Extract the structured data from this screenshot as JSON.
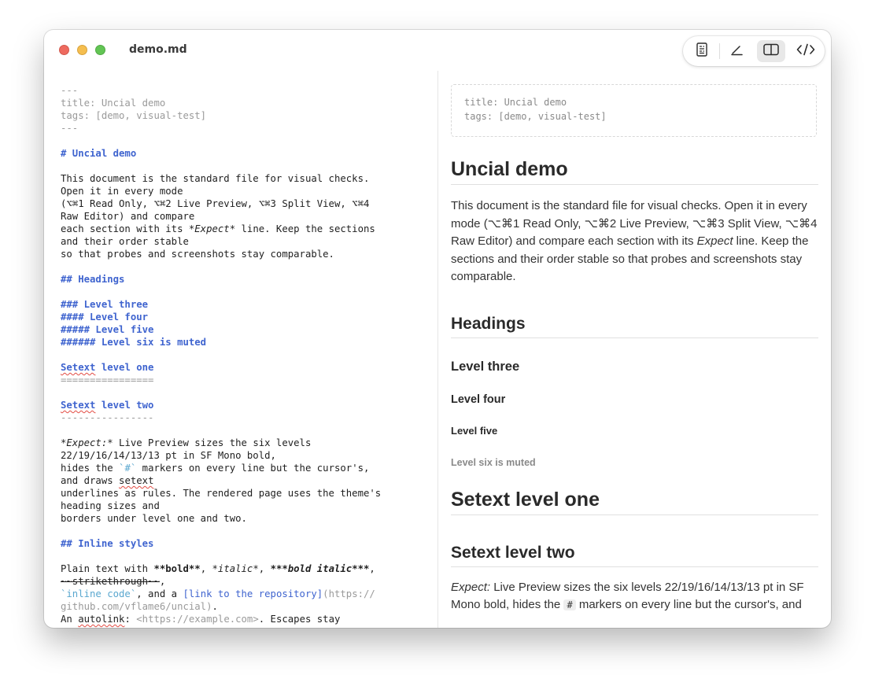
{
  "window": {
    "title": "demo.md"
  },
  "toolbar": {
    "icons": [
      "read-only-icon",
      "live-preview-icon",
      "split-view-icon",
      "raw-editor-icon"
    ],
    "active": "split-view"
  },
  "editor": {
    "fm_open": "---",
    "fm_title": "title: Uncial demo",
    "fm_tags": "tags: [demo, visual-test]",
    "fm_close": "---",
    "h1": "# Uncial demo",
    "intro": [
      "This document is the standard file for visual checks.",
      "Open it in every mode",
      "(⌥⌘1 Read Only, ⌥⌘2 Live Preview, ⌥⌘3 Split View, ⌥⌘4",
      "Raw Editor) and compare",
      "each section with its ",
      "*Expect*",
      " line. Keep the sections",
      "and their order stable",
      "so that probes and screenshots stay comparable."
    ],
    "headings_h2": "## Headings",
    "h3": "### Level three",
    "h4": "#### Level four",
    "h5": "##### Level five",
    "h6": "###### Level six is muted",
    "setext1_a": "Setext",
    "setext1_b": " level one",
    "setext1_rule": "================",
    "setext2_a": "Setext",
    "setext2_b": " level two",
    "setext2_rule": "----------------",
    "expect": [
      "*Expect:*",
      " Live Preview sizes the six levels",
      "22/19/16/14/13/13 pt in SF Mono bold,",
      "hides the ",
      "`#`",
      " markers on every line but the cursor's,",
      "and draws ",
      "setext",
      "underlines as rules. The rendered page uses the theme's",
      "heading sizes and",
      "borders under level one and two."
    ],
    "inline_h2": "## Inline styles",
    "inline": [
      "Plain text with ",
      "**bold**",
      ", ",
      "*italic*",
      ", ",
      "***bold italic***",
      ",",
      "~~strikethrough~~",
      ",",
      "`inline code`",
      ", and a ",
      "[link to the repository]",
      "(https://",
      "github.com/vflame6/uncial)",
      ".",
      "An ",
      "autolink",
      ": ",
      "<https://example.com>",
      ". Escapes stay"
    ]
  },
  "preview": {
    "fm_title": "title: Uncial demo",
    "fm_tags": "tags: [demo, visual-test]",
    "h1": "Uncial demo",
    "intro_a": "This document is the standard file for visual checks. Open it in every mode (⌥⌘1 Read Only, ⌥⌘2 Live Preview, ⌥⌘3 Split View, ⌥⌘4 Raw Editor) and compare each section with its ",
    "intro_em": "Expect",
    "intro_b": " line. Keep the sections and their order stable so that probes and screenshots stay comparable.",
    "h2": "Headings",
    "h3": "Level three",
    "h4": "Level four",
    "h5": "Level five",
    "h6": "Level six is muted",
    "setext1": "Setext level one",
    "setext2": "Setext level two",
    "expect_em": "Expect:",
    "expect_a": " Live Preview sizes the six levels 22/19/16/14/13/13 pt in SF Mono bold, hides the ",
    "expect_code": "#",
    "expect_b": " markers on every line but the cursor's, and"
  }
}
